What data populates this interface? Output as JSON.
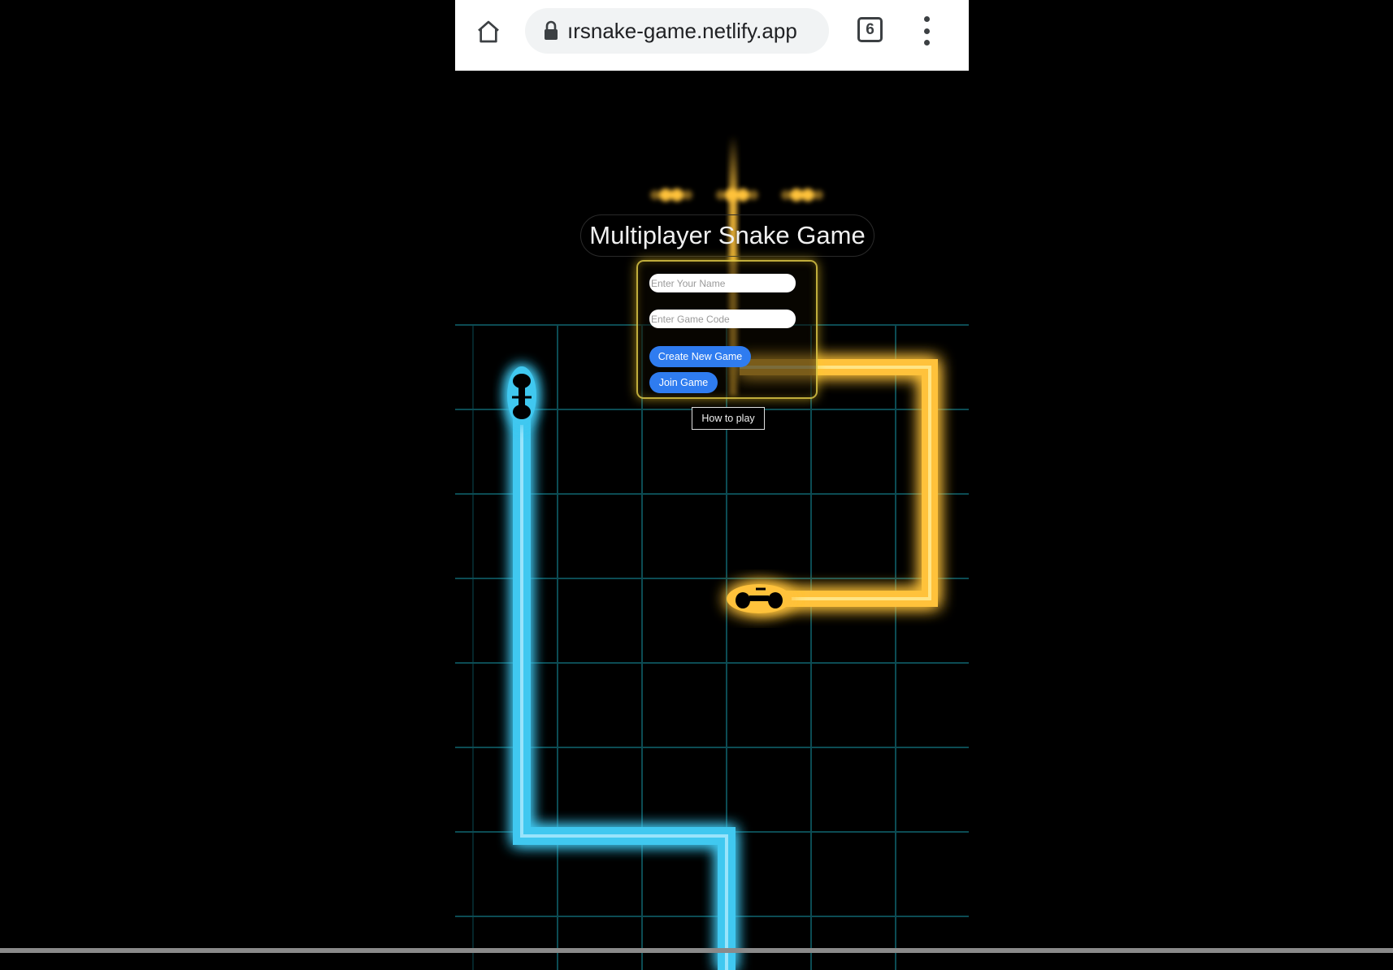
{
  "browser": {
    "url": "ersnake-game.netlify.app",
    "url_visible": "ırsnake-game.netlify.app",
    "tab_count": "6",
    "icons": {
      "home": "home-icon",
      "lock": "lock-icon",
      "tabs": "tab-switcher-icon",
      "menu": "more-vert-icon"
    }
  },
  "game": {
    "title": "Multiplayer Snake Game",
    "name_placeholder": "Enter Your Name",
    "code_placeholder": "Enter Game Code",
    "create_button": "Create New Game",
    "join_button": "Join Game",
    "how_to_play": "How to play",
    "colors": {
      "background": "#000000",
      "grid": "#0f5f6a",
      "blue_snake": "#3fc8f0",
      "yellow_snake": "#ffc23a",
      "button": "#2f7cf0"
    }
  }
}
